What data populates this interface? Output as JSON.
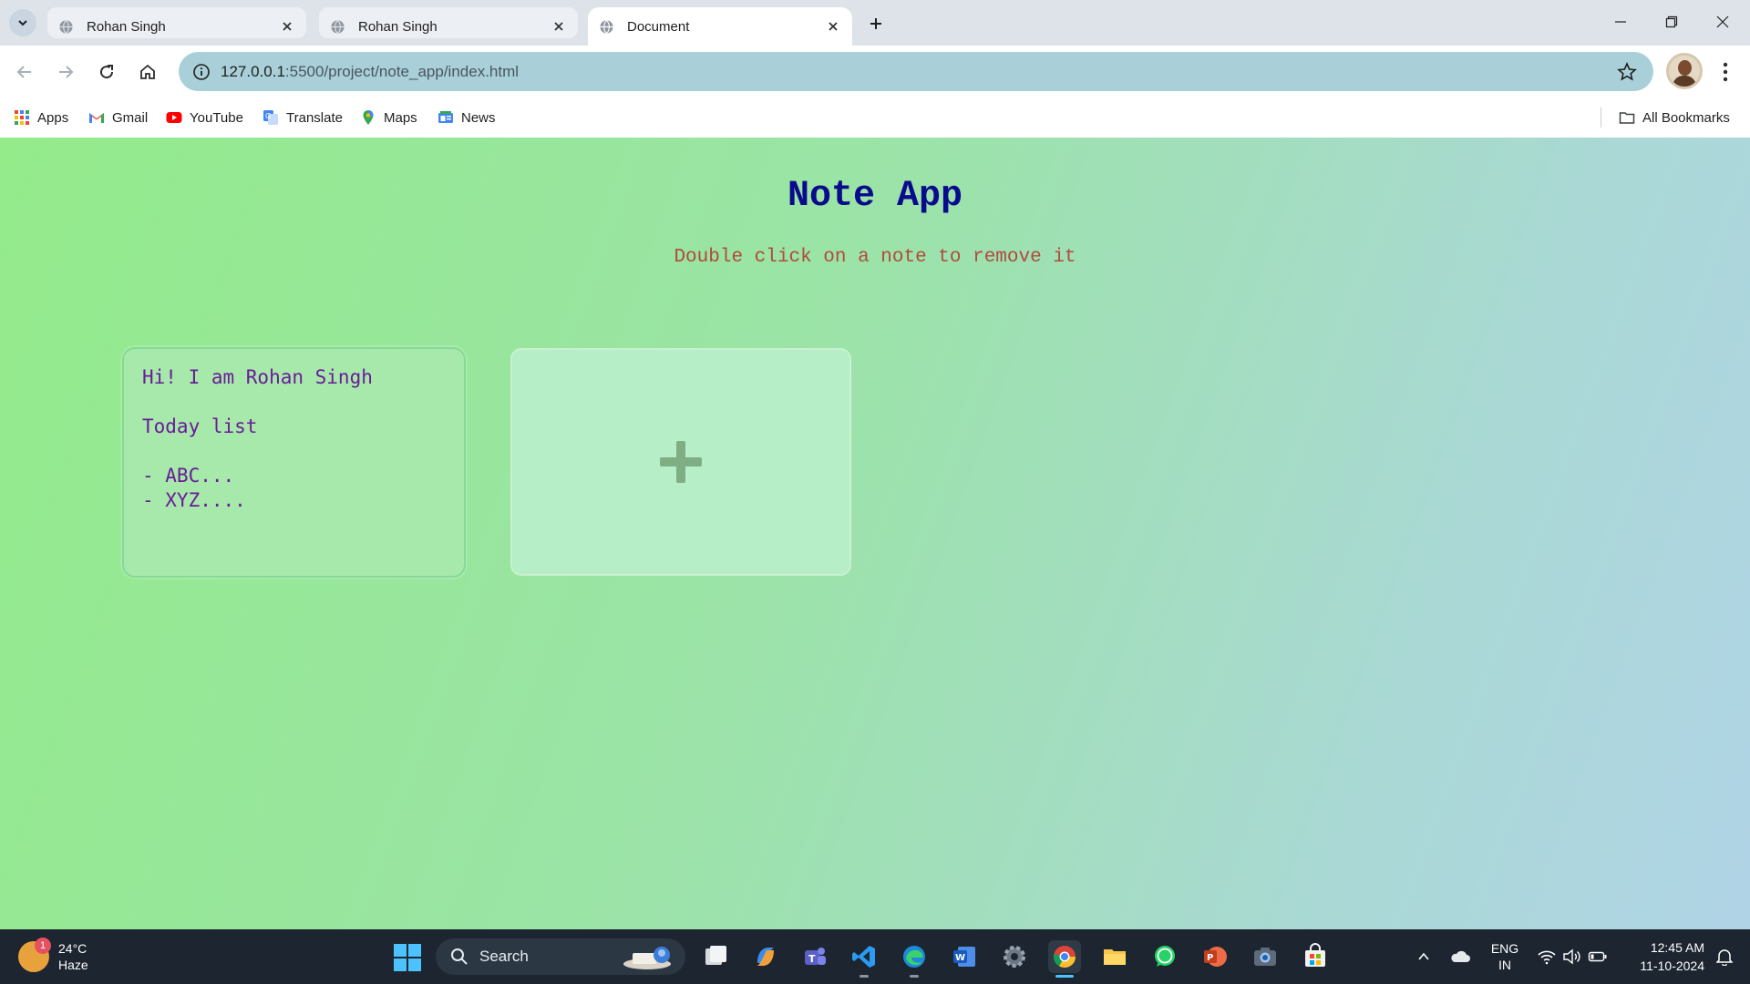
{
  "browser": {
    "tabs": [
      {
        "title": "Rohan Singh",
        "active": false
      },
      {
        "title": "Rohan Singh",
        "active": false
      },
      {
        "title": "Document",
        "active": true
      }
    ],
    "address": {
      "host": "127.0.0.1",
      "path": ":5500/project/note_app/index.html"
    },
    "bookmarks": [
      {
        "label": "Apps",
        "icon": "apps-grid-icon"
      },
      {
        "label": "Gmail",
        "icon": "gmail-icon"
      },
      {
        "label": "YouTube",
        "icon": "youtube-icon"
      },
      {
        "label": "Translate",
        "icon": "translate-icon"
      },
      {
        "label": "Maps",
        "icon": "maps-icon"
      },
      {
        "label": "News",
        "icon": "news-icon"
      }
    ],
    "all_bookmarks": "All Bookmarks"
  },
  "page": {
    "heading": "Note App",
    "instruction": "Double click on a note to remove it",
    "notes": [
      {
        "text": "Hi! I am Rohan Singh\n\nToday list\n\n- ABC...\n- XYZ...."
      }
    ],
    "add_button_icon": "plus-icon"
  },
  "taskbar": {
    "weather": {
      "temp": "24°C",
      "condition": "Haze",
      "badge": "1"
    },
    "search_placeholder": "Search",
    "language": {
      "line1": "ENG",
      "line2": "IN"
    },
    "time": "12:45 AM",
    "date": "11-10-2024",
    "pinned_apps": [
      "file-explorer-task-view-icon",
      "copilot-icon",
      "teams-icon",
      "vscode-icon",
      "edge-icon",
      "word-icon",
      "settings-icon",
      "chrome-icon",
      "folder-icon",
      "whatsapp-icon",
      "powerpoint-icon",
      "camera-icon",
      "store-icon"
    ]
  },
  "colors": {
    "heading": "#0a0a8c",
    "instruction": "#b04b3b",
    "note_text": "#6a1b9a",
    "accent": "#4cc2ff"
  }
}
